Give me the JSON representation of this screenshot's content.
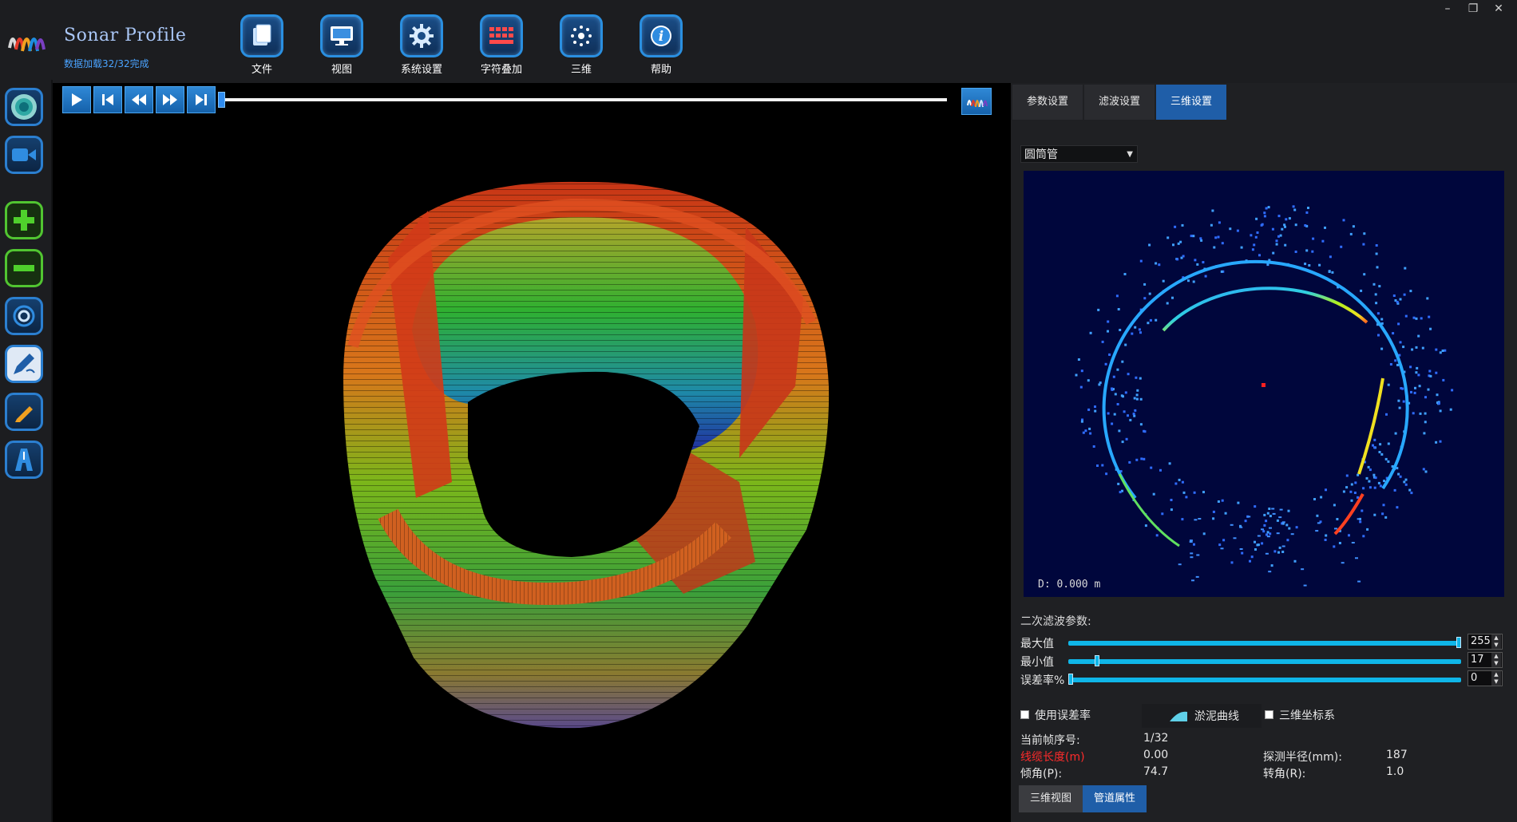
{
  "window": {
    "minimize": "–",
    "restore": "❐",
    "close": "✕"
  },
  "app": {
    "title": "Sonar Profile",
    "status": "数据加载32/32完成"
  },
  "toolbar": [
    {
      "label": "文件",
      "icon": "file-icon"
    },
    {
      "label": "视图",
      "icon": "monitor-icon"
    },
    {
      "label": "系统设置",
      "icon": "gear-icon"
    },
    {
      "label": "字符叠加",
      "icon": "keyboard-icon"
    },
    {
      "label": "三维",
      "icon": "sparkle-icon"
    },
    {
      "label": "帮助",
      "icon": "info-icon"
    }
  ],
  "sidebar": [
    {
      "name": "sonar-view-button",
      "icon": "sonar-icon"
    },
    {
      "name": "record-video-button",
      "icon": "camera-icon"
    },
    {
      "name": "zoom-in-button",
      "icon": "plus-icon"
    },
    {
      "name": "zoom-out-button",
      "icon": "minus-icon"
    },
    {
      "name": "snapshot-button",
      "icon": "lens-icon"
    },
    {
      "name": "annotate-button",
      "icon": "pen-icon"
    },
    {
      "name": "measure-button",
      "icon": "pencil-icon"
    },
    {
      "name": "pipeline-button",
      "icon": "road-icon"
    }
  ],
  "playback": {
    "buttons": [
      "play-icon",
      "skip-start-icon",
      "rewind-icon",
      "fast-forward-icon",
      "skip-end-icon"
    ],
    "progress": 0
  },
  "tabs": [
    {
      "label": "参数设置",
      "active": false
    },
    {
      "label": "滤波设置",
      "active": false
    },
    {
      "label": "三维设置",
      "active": true
    }
  ],
  "shape_select": {
    "value": "圆筒管"
  },
  "sonar": {
    "depth_text": "D: 0.000 m"
  },
  "filter": {
    "title": "二次滤波参数:",
    "max": {
      "label": "最大值",
      "value": "255",
      "fraction": 1.0
    },
    "min": {
      "label": "最小值",
      "value": "17",
      "fraction": 0.067
    },
    "error": {
      "label": "误差率%",
      "value": "0",
      "fraction": 0.0
    }
  },
  "options": {
    "use_error_rate": "使用误差率",
    "sludge_curve": "淤泥曲线",
    "coord_3d": "三维坐标系"
  },
  "info": {
    "frame_label": "当前帧序号:",
    "frame_value": "1/32",
    "cable_label": "线缆长度(m)",
    "cable_value": "0.00",
    "radius_label": "探测半径(mm):",
    "radius_value": "187",
    "pitch_label": "倾角(P):",
    "pitch_value": "74.7",
    "roll_label": "转角(R):",
    "roll_value": "1.0"
  },
  "bottom_tabs": [
    {
      "label": "三维视图",
      "active": false
    },
    {
      "label": "管道属性",
      "active": true
    }
  ],
  "colors": {
    "accent": "#1f5ea8",
    "slider": "#0fb6e8",
    "warning_text": "#ff2b2b"
  }
}
